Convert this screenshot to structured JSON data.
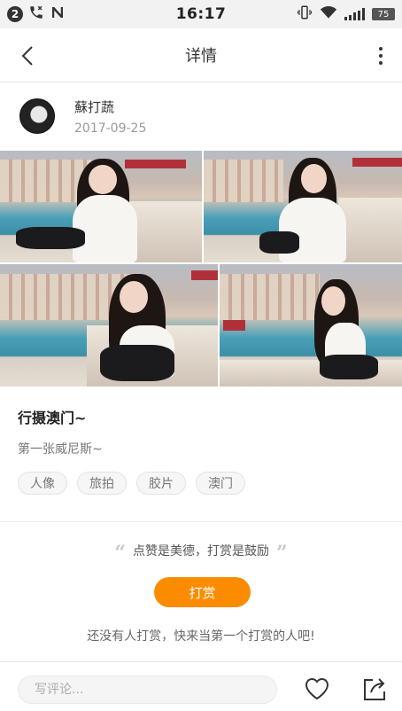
{
  "status_bar": {
    "notification_count": "2",
    "time": "16:17",
    "battery": "75"
  },
  "header": {
    "title": "详情"
  },
  "author": {
    "name": "蘇打蔬",
    "date": "2017-09-25"
  },
  "post": {
    "title": "行摄澳门~",
    "description": "第一张威尼斯~",
    "tags": [
      "人像",
      "旅拍",
      "胶片",
      "澳门"
    ]
  },
  "reward": {
    "quote_open": "“",
    "slogan": "点赞是美德，打赏是鼓励",
    "quote_close": "”",
    "button_label": "打赏",
    "hint": "还没有人打赏，快来当第一个打赏的人吧!"
  },
  "bottom_bar": {
    "comment_placeholder": "写评论..."
  },
  "colors": {
    "accent": "#fb8c00",
    "text_primary": "#222222",
    "text_secondary": "#999999"
  }
}
